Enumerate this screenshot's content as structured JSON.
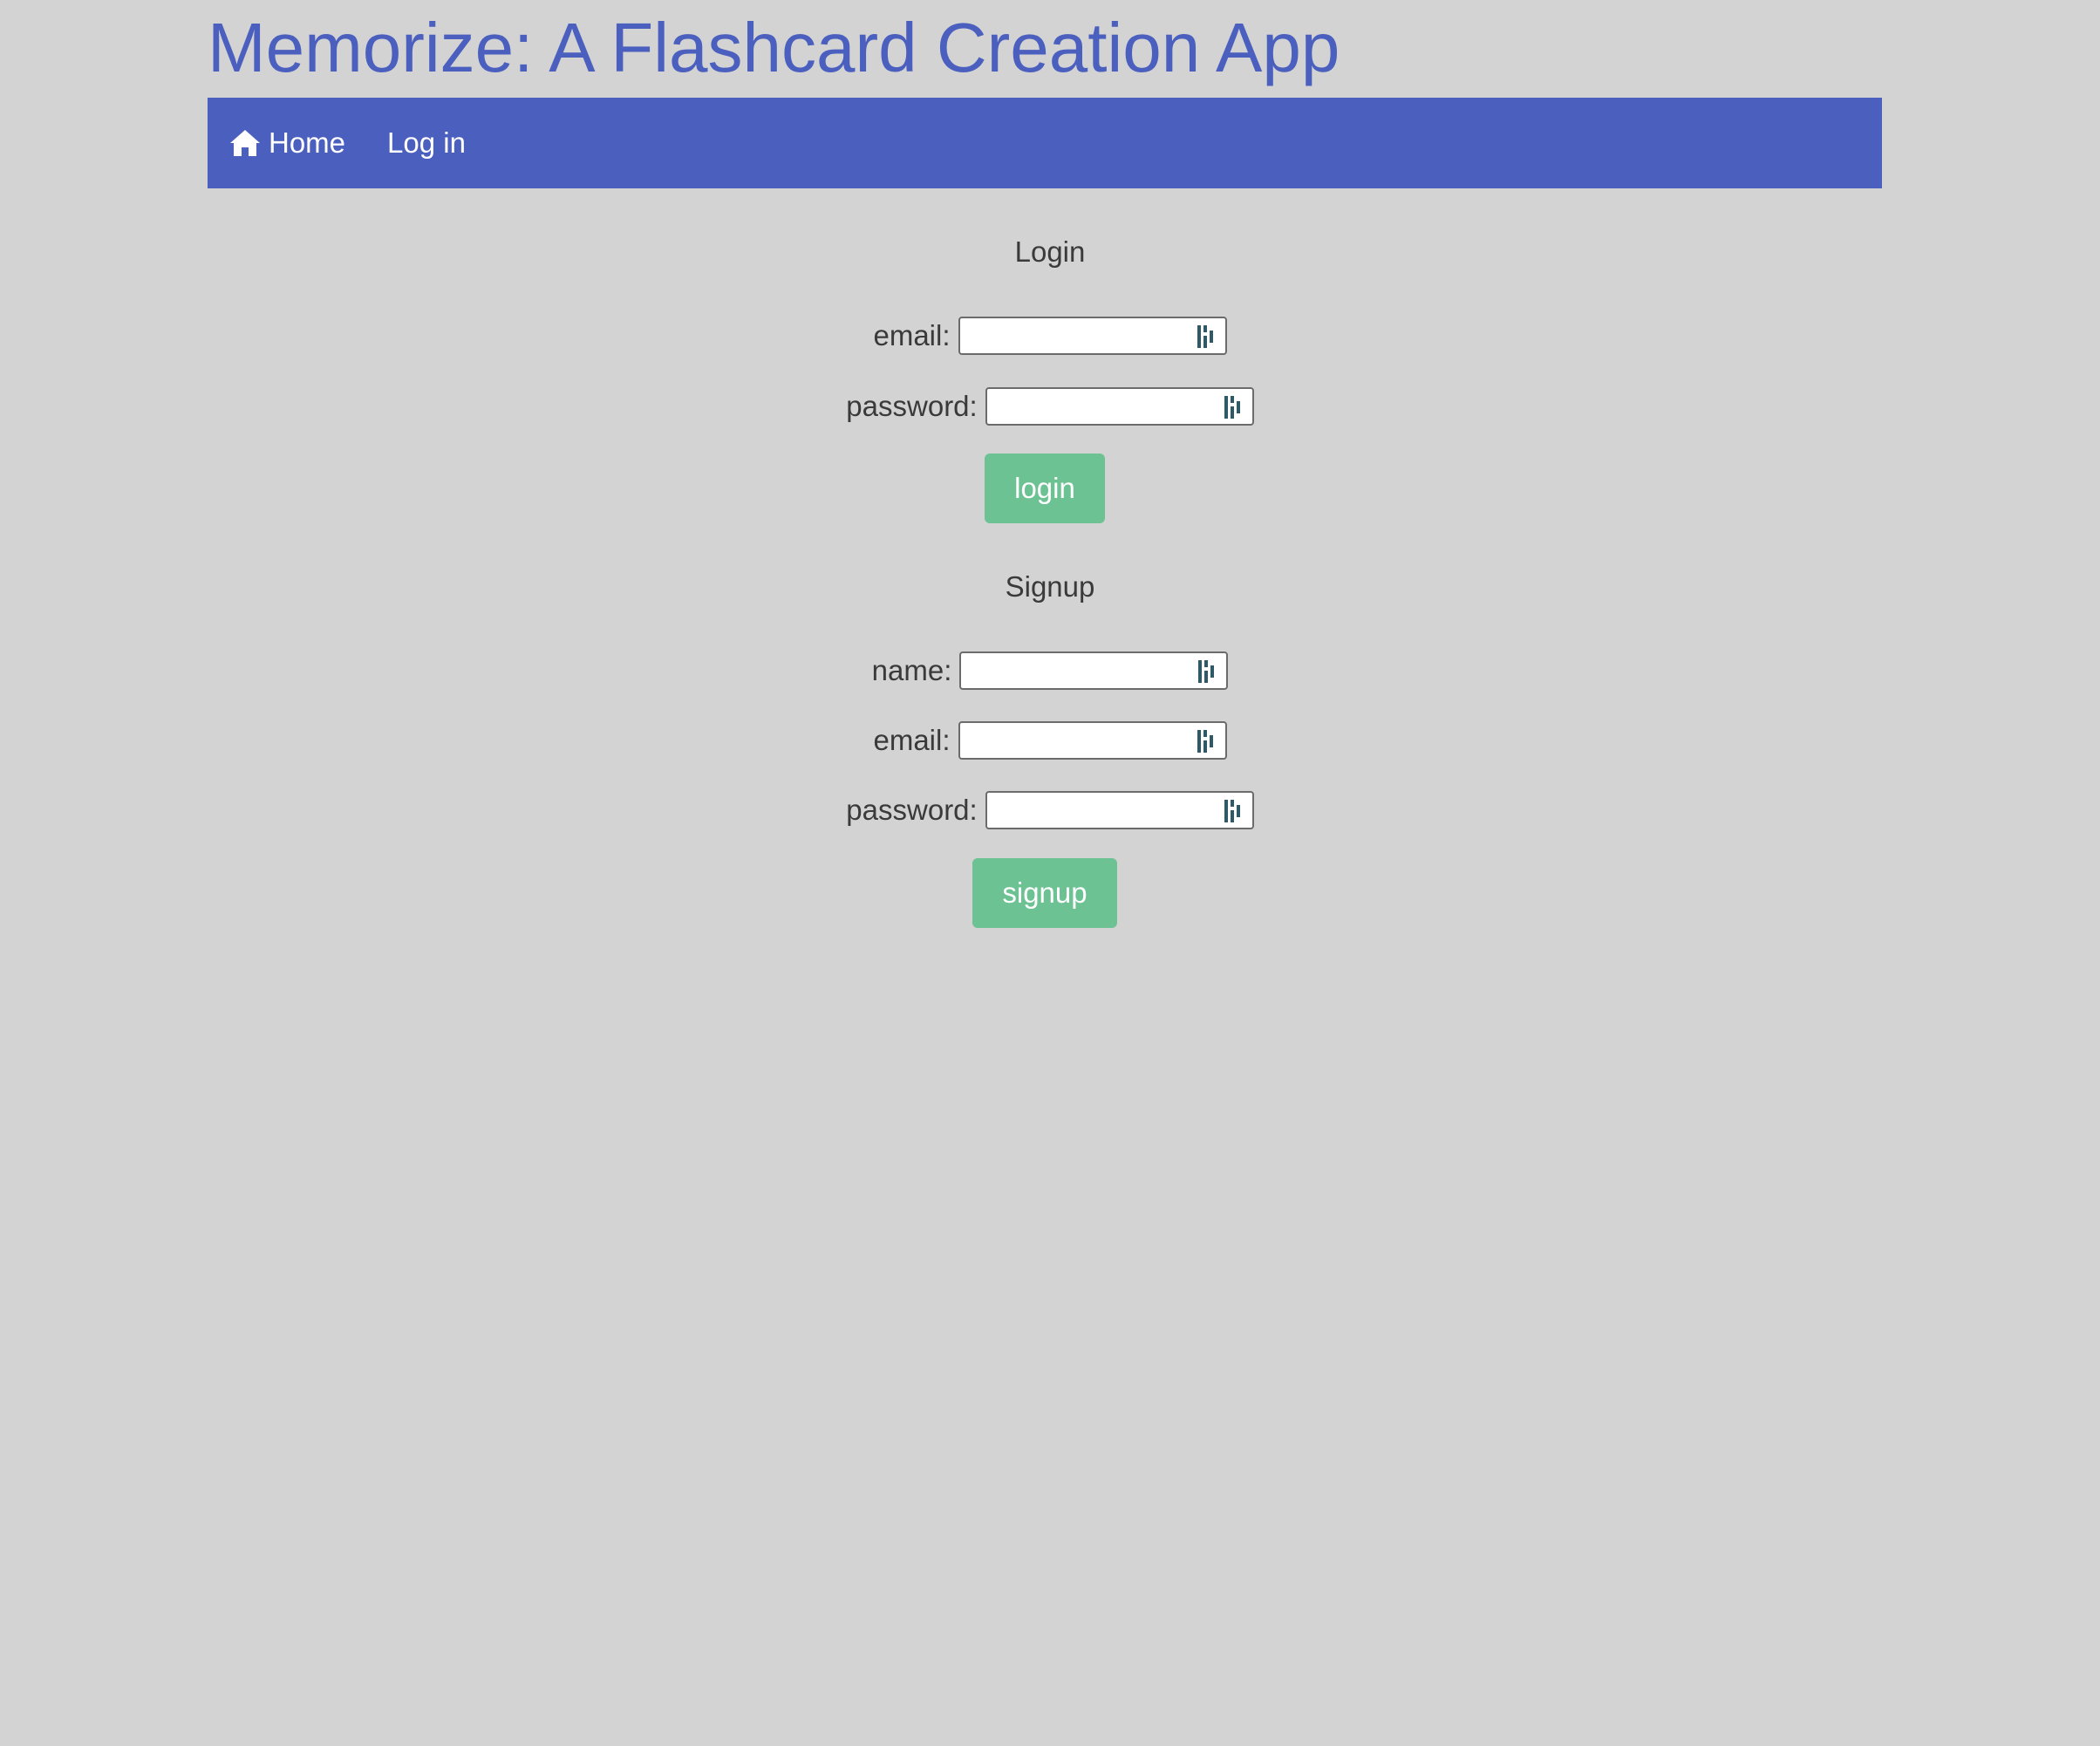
{
  "app": {
    "title": "Memorize: A Flashcard Creation App"
  },
  "nav": {
    "home_label": "Home",
    "login_label": "Log in"
  },
  "login": {
    "heading": "Login",
    "email_label": "email:",
    "email_value": "",
    "password_label": "password:",
    "password_value": "",
    "button_label": "login"
  },
  "signup": {
    "heading": "Signup",
    "name_label": "name:",
    "name_value": "",
    "email_label": "email:",
    "email_value": "",
    "password_label": "password:",
    "password_value": "",
    "button_label": "signup"
  },
  "icons": {
    "home": "home-icon",
    "password_manager": "password-manager-icon"
  },
  "colors": {
    "brand": "#4b5fbf",
    "button": "#6cc293",
    "background": "#d3d3d3"
  }
}
